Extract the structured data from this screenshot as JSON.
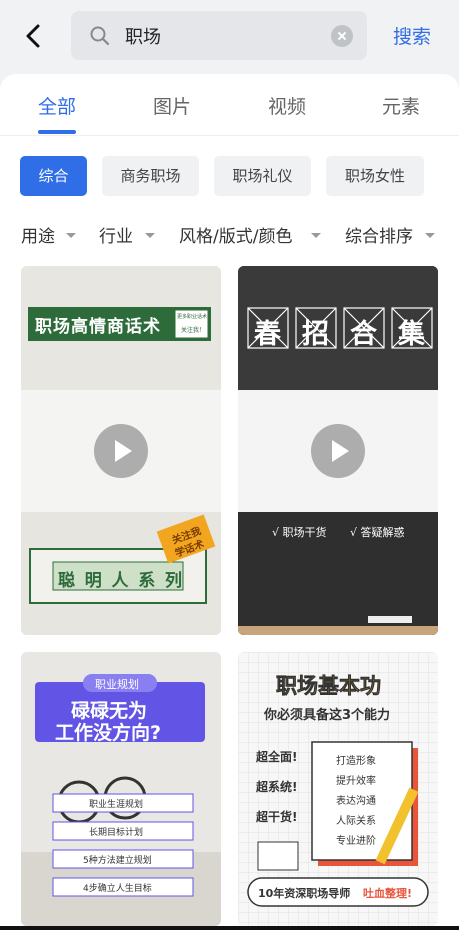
{
  "search": {
    "query": "职场",
    "button_label": "搜索"
  },
  "tabs": [
    {
      "label": "全部",
      "active": true
    },
    {
      "label": "图片",
      "active": false
    },
    {
      "label": "视频",
      "active": false
    },
    {
      "label": "元素",
      "active": false
    }
  ],
  "chips": [
    {
      "label": "综合",
      "active": true
    },
    {
      "label": "商务职场",
      "active": false
    },
    {
      "label": "职场礼仪",
      "active": false
    },
    {
      "label": "职场女性",
      "active": false
    }
  ],
  "filters": [
    "用途",
    "行业",
    "风格/版式/颜色",
    "综合排序"
  ],
  "cards": {
    "c1": {
      "banner": "职场高情商话术",
      "side_line1": "更多职业话术",
      "side_line2": "关注我！",
      "stamp_line1": "关注我",
      "stamp_line2": "学话术",
      "series": [
        "聪",
        "明",
        "人",
        "系",
        "列"
      ]
    },
    "c2": {
      "title_chars": [
        "春",
        "招",
        "合",
        "集"
      ],
      "item1": "√ 职场干货",
      "item2": "√ 答疑解惑"
    },
    "c3": {
      "tag": "职业规划",
      "line1": "碌碌无为",
      "line2": "工作没方向?",
      "rows": [
        "职业生涯规划",
        "长期目标计划",
        "5种方法建立规划",
        "4步确立人生目标"
      ]
    },
    "c4": {
      "title": "职场基本功",
      "subtitle": "你必须具备这3个能力",
      "left": [
        "超全面!",
        "超系统!",
        "超干货!"
      ],
      "checks": [
        "打造形象",
        "提升效率",
        "表达沟通",
        "人际关系",
        "专业进阶"
      ],
      "footer_a": "10年资深职场导师",
      "footer_b": "吐血整理!"
    }
  },
  "colors": {
    "accent": "#2f6ee6",
    "green_banner": "#2d6b3a",
    "purple": "#6255e6",
    "orange": "#f2a61f"
  }
}
